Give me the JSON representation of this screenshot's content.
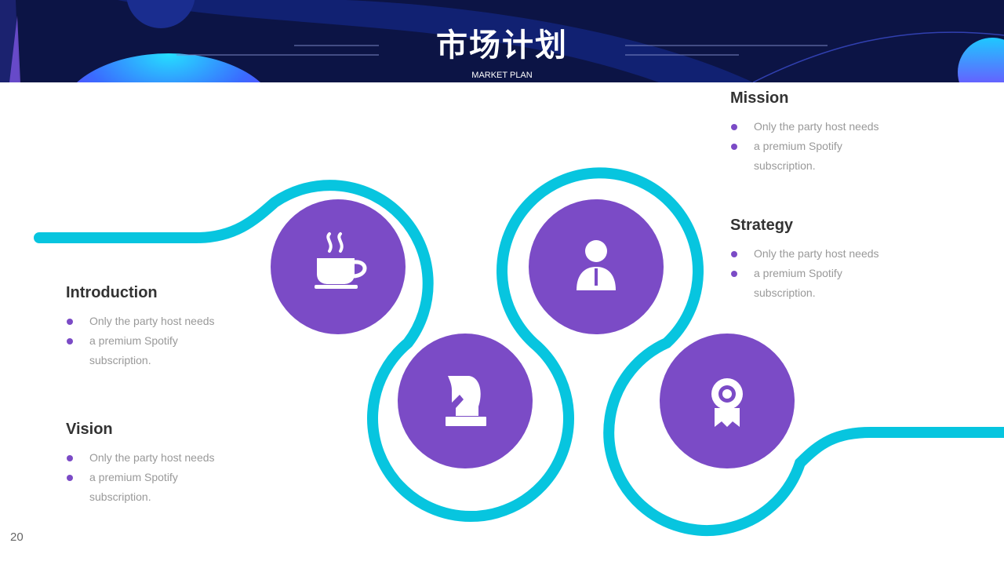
{
  "header": {
    "title": "市场计划",
    "subtitle": "MARKET PLAN"
  },
  "colors": {
    "header_bg": "#0c1445",
    "accent_cyan": "#07c5df",
    "accent_purple": "#7b4bc6",
    "heading_text": "#333333",
    "body_text": "#999999"
  },
  "blocks": {
    "introduction": {
      "title": "Introduction",
      "line1": "Only the party host needs",
      "line2": "a premium Spotify",
      "line3": "subscription."
    },
    "vision": {
      "title": "Vision",
      "line1": "Only the party host needs",
      "line2": "a premium Spotify",
      "line3": "subscription."
    },
    "mission": {
      "title": "Mission",
      "line1": "Only the party host needs",
      "line2": "a premium Spotify",
      "line3": "subscription."
    },
    "strategy": {
      "title": "Strategy",
      "line1": "Only the party host needs",
      "line2": "a premium Spotify",
      "line3": "subscription."
    }
  },
  "icons": [
    "coffee-cup-icon",
    "chess-knight-icon",
    "user-tie-icon",
    "award-badge-icon"
  ],
  "page_number": "20"
}
